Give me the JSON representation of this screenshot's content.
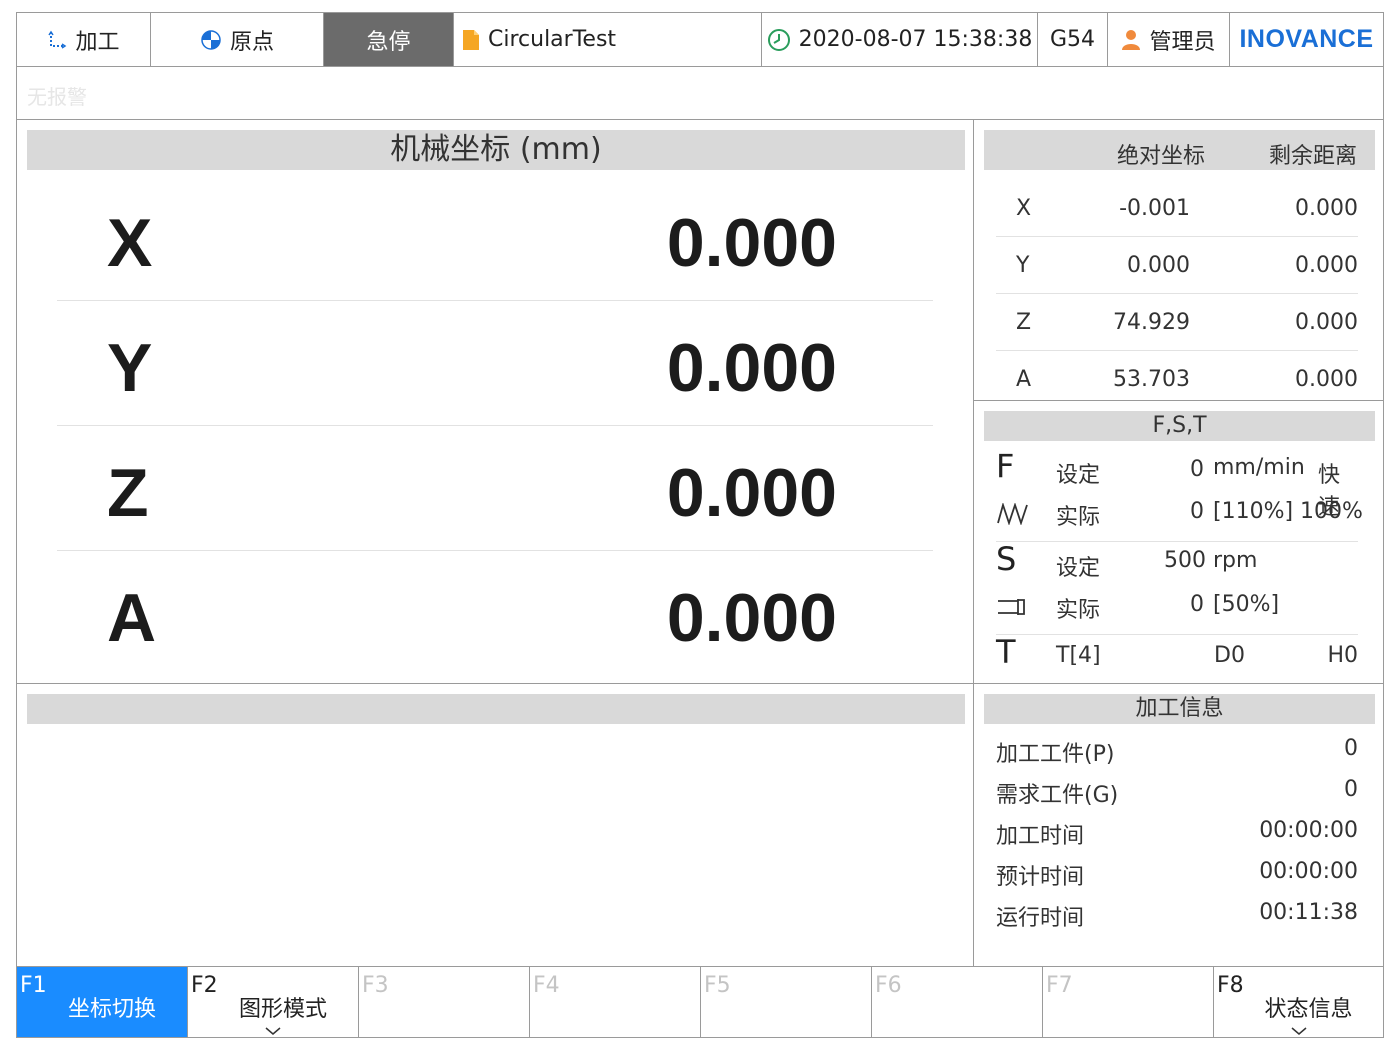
{
  "topbar": {
    "mode_label": "加工",
    "origin_label": "原点",
    "estop_label": "急停",
    "program_name": "CircularTest",
    "datetime": "2020-08-07 15:38:38",
    "coord_system": "G54",
    "user_label": "管理员",
    "brand": "INOVANCE"
  },
  "alarm": {
    "text": "无报警"
  },
  "mech": {
    "title": "机械坐标 (mm)",
    "axes": [
      {
        "name": "X",
        "value": "0.000"
      },
      {
        "name": "Y",
        "value": "0.000"
      },
      {
        "name": "Z",
        "value": "0.000"
      },
      {
        "name": "A",
        "value": "0.000"
      }
    ]
  },
  "coords": {
    "header_abs": "绝对坐标",
    "header_remain": "剩余距离",
    "rows": [
      {
        "axis": "X",
        "abs": "-0.001",
        "remain": "0.000"
      },
      {
        "axis": "Y",
        "abs": "0.000",
        "remain": "0.000"
      },
      {
        "axis": "Z",
        "abs": "74.929",
        "remain": "0.000"
      },
      {
        "axis": "A",
        "abs": "53.703",
        "remain": "0.000"
      }
    ]
  },
  "fst": {
    "title": "F,S,T",
    "f_letter": "F",
    "f_set_label": "设定",
    "f_set_value": "0",
    "f_unit": "mm/min",
    "f_rapid_label": "快速",
    "f_act_label": "实际",
    "f_act_value": "0",
    "f_override": "[110%]",
    "f_rapid_override": "100%",
    "s_letter": "S",
    "s_set_label": "设定",
    "s_set_value": "500",
    "s_unit": "rpm",
    "s_act_label": "实际",
    "s_act_value": "0",
    "s_override": "[50%]",
    "t_letter": "T",
    "t_tool": "T[4]",
    "t_d": "D0",
    "t_h": "H0"
  },
  "info": {
    "title": "加工信息",
    "rows": [
      {
        "label": "加工工件(P)",
        "value": "0"
      },
      {
        "label": "需求工件(G)",
        "value": "0"
      },
      {
        "label": "加工时间",
        "value": "00:00:00"
      },
      {
        "label": "预计时间",
        "value": "00:00:00"
      },
      {
        "label": "运行时间",
        "value": "00:11:38"
      }
    ]
  },
  "fkeys": [
    {
      "num": "F1",
      "label": "坐标切换"
    },
    {
      "num": "F2",
      "label": "图形模式"
    },
    {
      "num": "F3",
      "label": ""
    },
    {
      "num": "F4",
      "label": ""
    },
    {
      "num": "F5",
      "label": ""
    },
    {
      "num": "F6",
      "label": ""
    },
    {
      "num": "F7",
      "label": ""
    },
    {
      "num": "F8",
      "label": "状态信息"
    }
  ],
  "colors": {
    "active_key": "#1a8cff",
    "brand": "#1a6fd6",
    "estop_bg": "#6b6b6b",
    "panel_head": "#d9d9d9"
  }
}
